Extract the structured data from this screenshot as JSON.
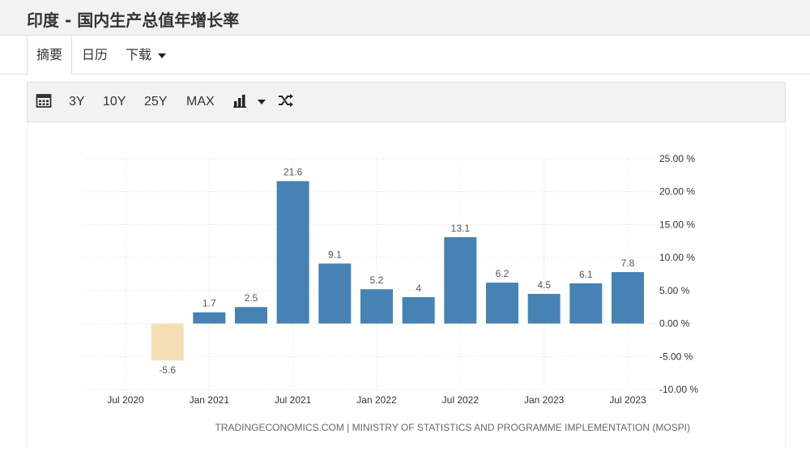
{
  "header": {
    "title": "印度 - 国内生产总值年增长率"
  },
  "tabs": [
    {
      "label": "摘要",
      "active": true
    },
    {
      "label": "日历",
      "active": false
    },
    {
      "label": "下载",
      "active": false
    }
  ],
  "toolbar": {
    "calendar_icon": "calendar-icon",
    "ranges": [
      "3Y",
      "10Y",
      "25Y",
      "MAX"
    ],
    "chart_type_icon": "bar-chart-icon",
    "shuffle_icon": "shuffle-icon"
  },
  "chart_data": {
    "type": "bar",
    "x": [
      "2020-10",
      "2021-01",
      "2021-04",
      "2021-07",
      "2021-10",
      "2022-01",
      "2022-04",
      "2022-07",
      "2022-10",
      "2023-01",
      "2023-04",
      "2023-07"
    ],
    "values": [
      -5.6,
      1.7,
      2.5,
      21.6,
      9.1,
      5.2,
      4,
      13.1,
      6.2,
      4.5,
      6.1,
      7.8
    ],
    "data_labels": [
      "-5.6",
      "1.7",
      "2.5",
      "21.6",
      "9.1",
      "5.2",
      "4",
      "13.1",
      "6.2",
      "4.5",
      "6.1",
      "7.8"
    ],
    "xtick_labels": [
      "Jul 2020",
      "Jan 2021",
      "Jul 2021",
      "Jan 2022",
      "Jul 2022",
      "Jan 2023",
      "Jul 2023"
    ],
    "yticks": [
      "25.00 %",
      "20.00 %",
      "15.00 %",
      "10.00 %",
      "5.00 %",
      "0.00 %",
      "-5.00 %",
      "-10.00 %"
    ],
    "ylim": [
      -10,
      25
    ],
    "yaxis_position": "right",
    "grid": true,
    "colors": {
      "positive": "#4682b4",
      "negative": "#f5deb3"
    },
    "source": "TRADINGECONOMICS.COM | MINISTRY OF STATISTICS AND PROGRAMME IMPLEMENTATION (MOSPI)"
  }
}
